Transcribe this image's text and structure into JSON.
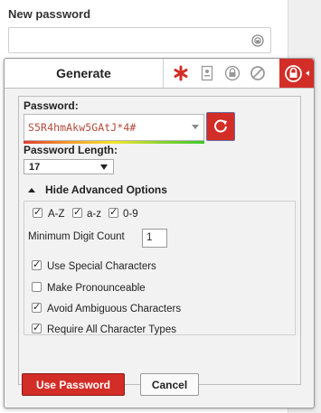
{
  "field": {
    "label": "New password",
    "value": ""
  },
  "popup": {
    "tab_generate": "Generate",
    "tab_icons": [
      "asterisk-icon",
      "form-fill-icon",
      "lastpass-lock-icon",
      "disable-icon",
      "lastpass-menu-icon"
    ],
    "password_label": "Password:",
    "generated_password": "S5R4hmAkw5GAtJ*4#",
    "length_label": "Password Length:",
    "length_value": "17",
    "advanced_toggle": "Hide Advanced Options",
    "options": {
      "az_upper": {
        "label": "A-Z",
        "checked": true
      },
      "az_lower": {
        "label": "a-z",
        "checked": true
      },
      "digits": {
        "label": "0-9",
        "checked": true
      },
      "min_digit_label": "Minimum Digit Count",
      "min_digit_value": "1",
      "special": {
        "label": "Use Special Characters",
        "checked": true
      },
      "pronounceable": {
        "label": "Make Pronounceable",
        "checked": false
      },
      "ambiguous": {
        "label": "Avoid Ambiguous Characters",
        "checked": true
      },
      "all_types": {
        "label": "Require All Character Types",
        "checked": true
      }
    },
    "use_button": "Use Password",
    "cancel_button": "Cancel"
  },
  "colors": {
    "accent": "#d32d27",
    "panel_bg": "#f2f2f2"
  }
}
